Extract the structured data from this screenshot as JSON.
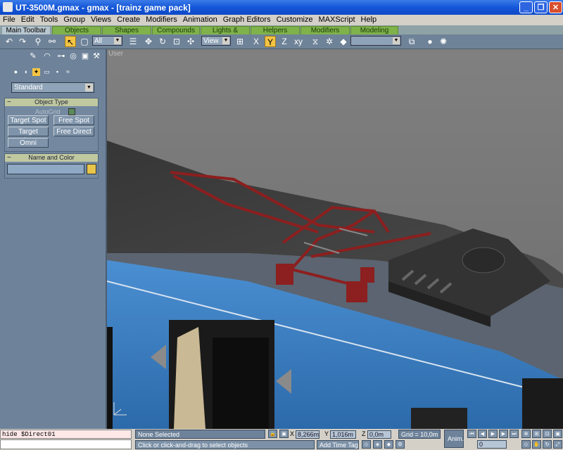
{
  "window": {
    "title": "UT-3500M.gmax - gmax - [trainz game pack]",
    "min": "_",
    "max": "❐",
    "close": "✕"
  },
  "menu": [
    "File",
    "Edit",
    "Tools",
    "Group",
    "Views",
    "Create",
    "Modifiers",
    "Animation",
    "Graph Editors",
    "Customize",
    "MAXScript",
    "Help"
  ],
  "tabs": [
    "Main Toolbar",
    "Objects",
    "Shapes",
    "Compounds",
    "Lights & Cameras",
    "Helpers",
    "Modifiers",
    "Modeling"
  ],
  "toolbar": {
    "selection_filter": "All",
    "ref_coord": "View",
    "named_selection": ""
  },
  "command_panel": {
    "category_dropdown": "Standard",
    "object_type": {
      "header": "Object Type",
      "autogrid": "AutoGrid",
      "buttons": [
        "Target Spot",
        "Free Spot",
        "Target Direct",
        "Free Direct",
        "Omni"
      ]
    },
    "name_color": {
      "header": "Name and Color",
      "name_value": ""
    }
  },
  "viewport": {
    "label": "User",
    "colors": {
      "background": "#7d7d7d",
      "car_body": "#3c7fc2",
      "pantograph": "#8c1f1f",
      "roof": "#2a2a2a"
    }
  },
  "status": {
    "listener_text": "hide $Direct01",
    "selection": "None Selected",
    "prompt": "Click or click-and-drag to select objects",
    "x_label": "X",
    "x": "8,266m",
    "y_label": "Y",
    "y": "1,016m",
    "z_label": "Z",
    "z": "0,0m",
    "grid": "Grid = 10,0m",
    "anim": "Anim.",
    "add_time_tag": "Add Time Tag",
    "frame": "0"
  },
  "accent_colors": {
    "active_tab": "#b7c6cf",
    "tab": "#7fb24a",
    "selected_tool": "#f4c443",
    "title_bar": "#1456d8"
  }
}
